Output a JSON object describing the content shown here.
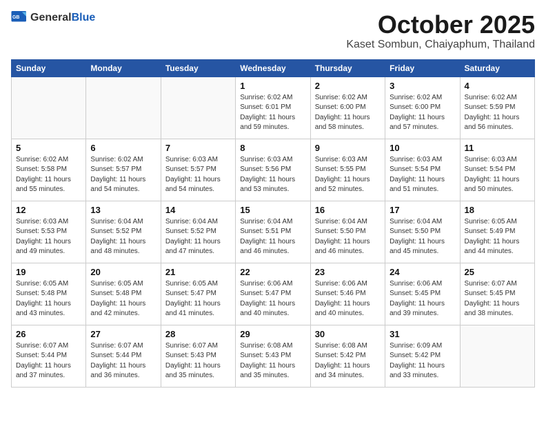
{
  "header": {
    "logo_general": "General",
    "logo_blue": "Blue",
    "month": "October 2025",
    "location": "Kaset Sombun, Chaiyaphum, Thailand"
  },
  "weekdays": [
    "Sunday",
    "Monday",
    "Tuesday",
    "Wednesday",
    "Thursday",
    "Friday",
    "Saturday"
  ],
  "weeks": [
    [
      {
        "day": "",
        "info": ""
      },
      {
        "day": "",
        "info": ""
      },
      {
        "day": "",
        "info": ""
      },
      {
        "day": "1",
        "info": "Sunrise: 6:02 AM\nSunset: 6:01 PM\nDaylight: 11 hours\nand 59 minutes."
      },
      {
        "day": "2",
        "info": "Sunrise: 6:02 AM\nSunset: 6:00 PM\nDaylight: 11 hours\nand 58 minutes."
      },
      {
        "day": "3",
        "info": "Sunrise: 6:02 AM\nSunset: 6:00 PM\nDaylight: 11 hours\nand 57 minutes."
      },
      {
        "day": "4",
        "info": "Sunrise: 6:02 AM\nSunset: 5:59 PM\nDaylight: 11 hours\nand 56 minutes."
      }
    ],
    [
      {
        "day": "5",
        "info": "Sunrise: 6:02 AM\nSunset: 5:58 PM\nDaylight: 11 hours\nand 55 minutes."
      },
      {
        "day": "6",
        "info": "Sunrise: 6:02 AM\nSunset: 5:57 PM\nDaylight: 11 hours\nand 54 minutes."
      },
      {
        "day": "7",
        "info": "Sunrise: 6:03 AM\nSunset: 5:57 PM\nDaylight: 11 hours\nand 54 minutes."
      },
      {
        "day": "8",
        "info": "Sunrise: 6:03 AM\nSunset: 5:56 PM\nDaylight: 11 hours\nand 53 minutes."
      },
      {
        "day": "9",
        "info": "Sunrise: 6:03 AM\nSunset: 5:55 PM\nDaylight: 11 hours\nand 52 minutes."
      },
      {
        "day": "10",
        "info": "Sunrise: 6:03 AM\nSunset: 5:54 PM\nDaylight: 11 hours\nand 51 minutes."
      },
      {
        "day": "11",
        "info": "Sunrise: 6:03 AM\nSunset: 5:54 PM\nDaylight: 11 hours\nand 50 minutes."
      }
    ],
    [
      {
        "day": "12",
        "info": "Sunrise: 6:03 AM\nSunset: 5:53 PM\nDaylight: 11 hours\nand 49 minutes."
      },
      {
        "day": "13",
        "info": "Sunrise: 6:04 AM\nSunset: 5:52 PM\nDaylight: 11 hours\nand 48 minutes."
      },
      {
        "day": "14",
        "info": "Sunrise: 6:04 AM\nSunset: 5:52 PM\nDaylight: 11 hours\nand 47 minutes."
      },
      {
        "day": "15",
        "info": "Sunrise: 6:04 AM\nSunset: 5:51 PM\nDaylight: 11 hours\nand 46 minutes."
      },
      {
        "day": "16",
        "info": "Sunrise: 6:04 AM\nSunset: 5:50 PM\nDaylight: 11 hours\nand 46 minutes."
      },
      {
        "day": "17",
        "info": "Sunrise: 6:04 AM\nSunset: 5:50 PM\nDaylight: 11 hours\nand 45 minutes."
      },
      {
        "day": "18",
        "info": "Sunrise: 6:05 AM\nSunset: 5:49 PM\nDaylight: 11 hours\nand 44 minutes."
      }
    ],
    [
      {
        "day": "19",
        "info": "Sunrise: 6:05 AM\nSunset: 5:48 PM\nDaylight: 11 hours\nand 43 minutes."
      },
      {
        "day": "20",
        "info": "Sunrise: 6:05 AM\nSunset: 5:48 PM\nDaylight: 11 hours\nand 42 minutes."
      },
      {
        "day": "21",
        "info": "Sunrise: 6:05 AM\nSunset: 5:47 PM\nDaylight: 11 hours\nand 41 minutes."
      },
      {
        "day": "22",
        "info": "Sunrise: 6:06 AM\nSunset: 5:47 PM\nDaylight: 11 hours\nand 40 minutes."
      },
      {
        "day": "23",
        "info": "Sunrise: 6:06 AM\nSunset: 5:46 PM\nDaylight: 11 hours\nand 40 minutes."
      },
      {
        "day": "24",
        "info": "Sunrise: 6:06 AM\nSunset: 5:45 PM\nDaylight: 11 hours\nand 39 minutes."
      },
      {
        "day": "25",
        "info": "Sunrise: 6:07 AM\nSunset: 5:45 PM\nDaylight: 11 hours\nand 38 minutes."
      }
    ],
    [
      {
        "day": "26",
        "info": "Sunrise: 6:07 AM\nSunset: 5:44 PM\nDaylight: 11 hours\nand 37 minutes."
      },
      {
        "day": "27",
        "info": "Sunrise: 6:07 AM\nSunset: 5:44 PM\nDaylight: 11 hours\nand 36 minutes."
      },
      {
        "day": "28",
        "info": "Sunrise: 6:07 AM\nSunset: 5:43 PM\nDaylight: 11 hours\nand 35 minutes."
      },
      {
        "day": "29",
        "info": "Sunrise: 6:08 AM\nSunset: 5:43 PM\nDaylight: 11 hours\nand 35 minutes."
      },
      {
        "day": "30",
        "info": "Sunrise: 6:08 AM\nSunset: 5:42 PM\nDaylight: 11 hours\nand 34 minutes."
      },
      {
        "day": "31",
        "info": "Sunrise: 6:09 AM\nSunset: 5:42 PM\nDaylight: 11 hours\nand 33 minutes."
      },
      {
        "day": "",
        "info": ""
      }
    ]
  ]
}
